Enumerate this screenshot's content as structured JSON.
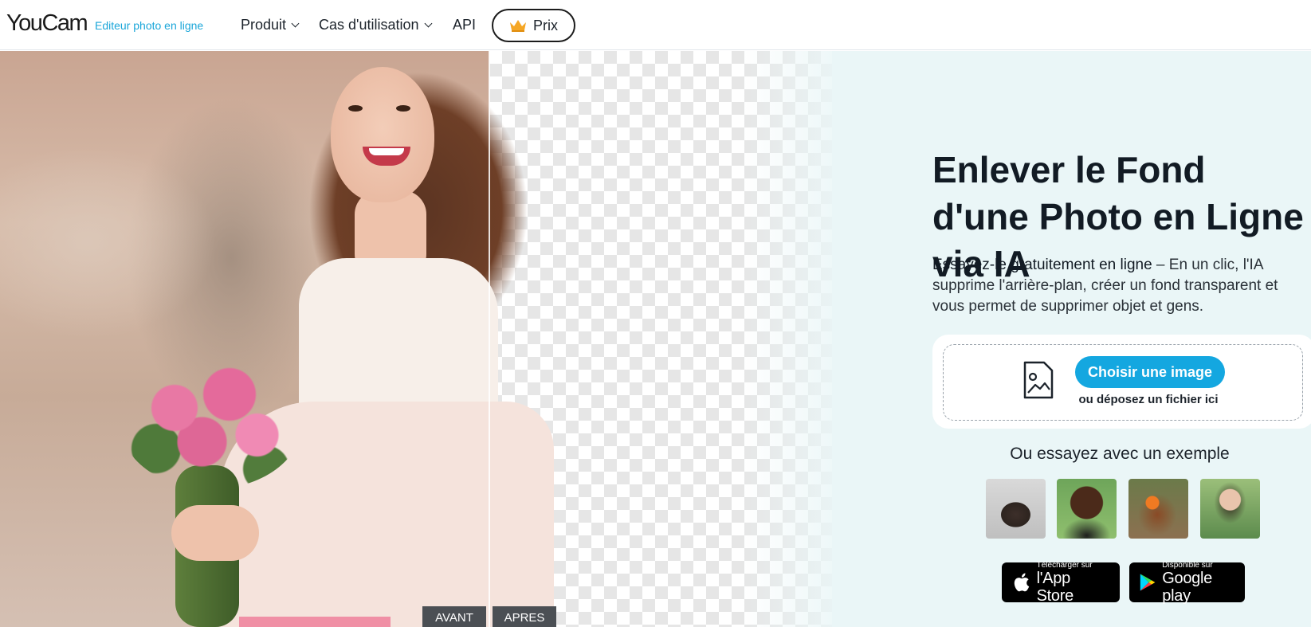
{
  "header": {
    "logo": "YouCam",
    "tagline": "Editeur photo en ligne",
    "nav": [
      {
        "label": "Produit"
      },
      {
        "label": "Cas d'utilisation"
      },
      {
        "label": "API"
      }
    ],
    "pricing_label": "Prix"
  },
  "hero": {
    "before_label": "AVANT",
    "after_label": "APRES",
    "title": "Enlever le Fond d'une Photo en Ligne via IA",
    "description_strong": "Essayez-le gratuitement en ligne",
    "description_rest": " – En un clic, l'IA supprime l'arrière-plan, créer un fond transparent et vous permet de supprimer objet et gens.",
    "upload": {
      "button_label": "Choisir une image",
      "drop_text": "ou déposez un fichier ici"
    },
    "examples_title": "Ou essayez avec un exemple",
    "stores": {
      "apple_small": "Télécharger sur",
      "apple_big": "l'App Store",
      "google_small": "Disponible sur",
      "google_big": "Google play"
    }
  },
  "colors": {
    "accent": "#14a7e0",
    "hero_bg": "#eaf6f7",
    "tag_bg": "#4b4f54"
  }
}
